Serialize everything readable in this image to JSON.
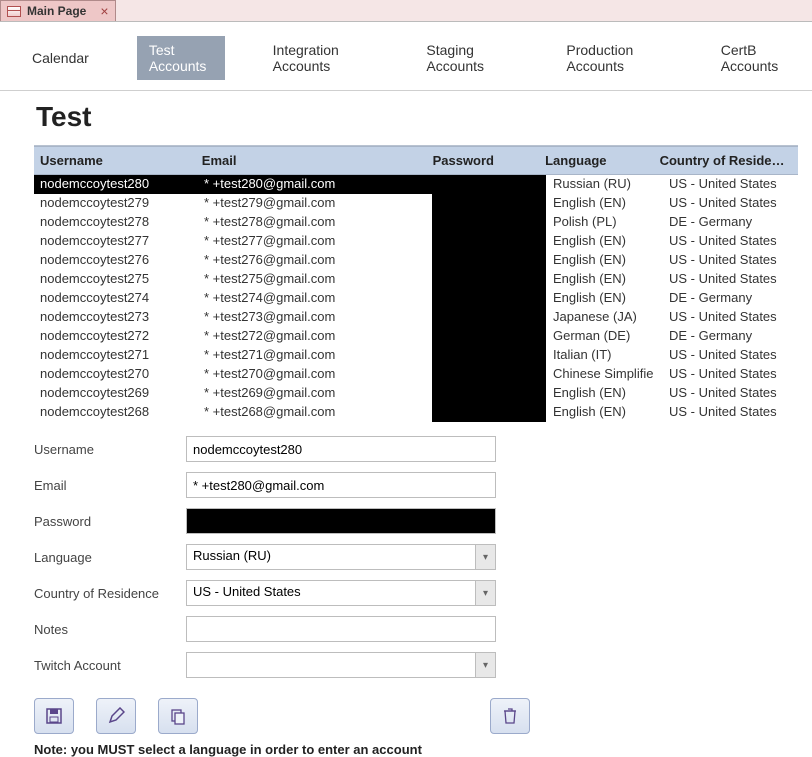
{
  "window_tab": {
    "title": "Main Page"
  },
  "nav_tabs": {
    "items": [
      {
        "label": "Calendar"
      },
      {
        "label": "Test Accounts"
      },
      {
        "label": "Integration Accounts"
      },
      {
        "label": "Staging Accounts"
      },
      {
        "label": "Production Accounts"
      },
      {
        "label": "CertB Accounts"
      }
    ],
    "active_index": 1
  },
  "page_title": "Test",
  "grid": {
    "columns": {
      "username": "Username",
      "email": "Email",
      "password": "Password",
      "language": "Language",
      "country": "Country of Residence"
    },
    "rows": [
      {
        "username": "nodemccoytest280",
        "email": "* +test280@gmail.com",
        "language": "Russian (RU)",
        "country": "US - United States",
        "selected": true
      },
      {
        "username": "nodemccoytest279",
        "email": "* +test279@gmail.com",
        "language": "English (EN)",
        "country": "US - United States"
      },
      {
        "username": "nodemccoytest278",
        "email": "* +test278@gmail.com",
        "language": "Polish (PL)",
        "country": "DE - Germany"
      },
      {
        "username": "nodemccoytest277",
        "email": "* +test277@gmail.com",
        "language": "English (EN)",
        "country": "US - United States"
      },
      {
        "username": "nodemccoytest276",
        "email": "* +test276@gmail.com",
        "language": "English (EN)",
        "country": "US - United States"
      },
      {
        "username": "nodemccoytest275",
        "email": "* +test275@gmail.com",
        "language": "English (EN)",
        "country": "US - United States"
      },
      {
        "username": "nodemccoytest274",
        "email": "* +test274@gmail.com",
        "language": "English (EN)",
        "country": "DE - Germany"
      },
      {
        "username": "nodemccoytest273",
        "email": "* +test273@gmail.com",
        "language": "Japanese (JA)",
        "country": "US - United States"
      },
      {
        "username": "nodemccoytest272",
        "email": "* +test272@gmail.com",
        "language": "German (DE)",
        "country": "DE - Germany"
      },
      {
        "username": "nodemccoytest271",
        "email": "* +test271@gmail.com",
        "language": "Italian (IT)",
        "country": "US - United States"
      },
      {
        "username": "nodemccoytest270",
        "email": "* +test270@gmail.com",
        "language": "Chinese Simplifie",
        "country": "US - United States"
      },
      {
        "username": "nodemccoytest269",
        "email": "* +test269@gmail.com",
        "language": "English (EN)",
        "country": "US - United States"
      },
      {
        "username": "nodemccoytest268",
        "email": "* +test268@gmail.com",
        "language": "English (EN)",
        "country": "US - United States"
      }
    ]
  },
  "form": {
    "labels": {
      "username": "Username",
      "email": "Email",
      "password": "Password",
      "language": "Language",
      "country": "Country of Residence",
      "notes": "Notes",
      "twitch": "Twitch Account"
    },
    "values": {
      "username": "nodemccoytest280",
      "email": "* +test280@gmail.com",
      "password": "",
      "language": "Russian (RU)",
      "country": "US - United States",
      "notes": "",
      "twitch": ""
    }
  },
  "note_text": "Note: you MUST select a language in order to enter an account"
}
